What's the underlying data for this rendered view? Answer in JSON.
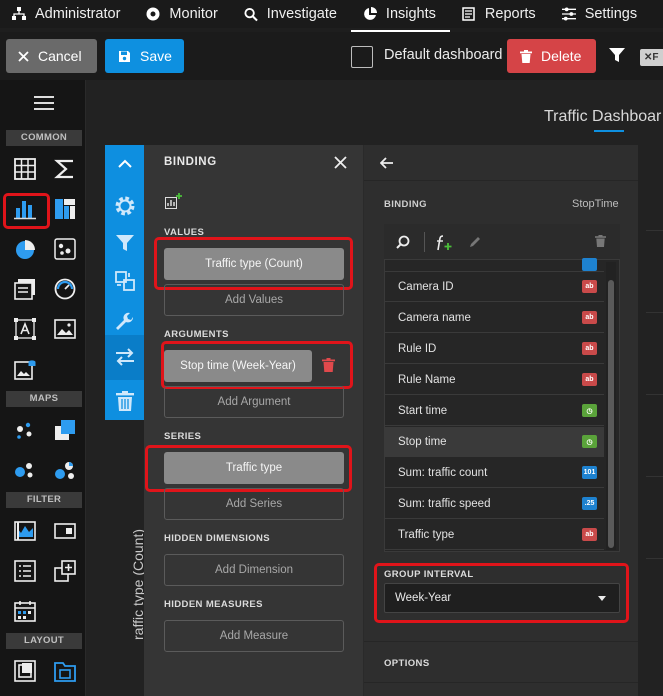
{
  "nav": {
    "items": [
      {
        "label": "Administrator",
        "icon": "org-chart-icon"
      },
      {
        "label": "Monitor",
        "icon": "camera-icon"
      },
      {
        "label": "Investigate",
        "icon": "search-icon"
      },
      {
        "label": "Insights",
        "icon": "pie-chart-icon",
        "active": true
      },
      {
        "label": "Reports",
        "icon": "report-icon"
      },
      {
        "label": "Settings",
        "icon": "sliders-icon"
      }
    ]
  },
  "toolbar": {
    "cancel_label": "Cancel",
    "save_label": "Save",
    "default_dashboard_label": "Default dashboard",
    "default_dashboard_checked": false,
    "delete_label": "Delete",
    "filter_chip": "F"
  },
  "toolbox": {
    "sections": {
      "common": "COMMON",
      "maps": "MAPS",
      "filter": "FILTER",
      "layout": "LAYOUT"
    }
  },
  "canvas": {
    "title": "Traffic Dashboar",
    "axis_label": "raffic type (Count)"
  },
  "binding_panel": {
    "title": "BINDING",
    "values_label": "VALUES",
    "values_item": "Traffic type (Count)",
    "add_values": "Add Values",
    "arguments_label": "ARGUMENTS",
    "arguments_item": "Stop time (Week-Year)",
    "add_argument": "Add Argument",
    "series_label": "SERIES",
    "series_item": "Traffic type",
    "add_series": "Add Series",
    "hidden_dimensions_label": "HIDDEN DIMENSIONS",
    "add_dimension": "Add Dimension",
    "hidden_measures_label": "HIDDEN MEASURES",
    "add_measure": "Add Measure"
  },
  "field_panel": {
    "binding_label": "BINDING",
    "field_name": "StopTime",
    "fields": [
      {
        "label": "Camera ID",
        "type": "ab"
      },
      {
        "label": "Camera name",
        "type": "ab"
      },
      {
        "label": "Rule ID",
        "type": "ab"
      },
      {
        "label": "Rule Name",
        "type": "ab"
      },
      {
        "label": "Start time",
        "type": "time"
      },
      {
        "label": "Stop time",
        "type": "time",
        "selected": true
      },
      {
        "label": "Sum: traffic count",
        "type": "num",
        "badge": "101"
      },
      {
        "label": "Sum: traffic speed",
        "type": "num",
        "badge": ".25"
      },
      {
        "label": "Traffic type",
        "type": "ab"
      }
    ],
    "group_interval_label": "GROUP INTERVAL",
    "group_interval_value": "Week-Year",
    "options_label": "OPTIONS"
  },
  "colors": {
    "accent_blue": "#0e90e0",
    "delete_red": "#d54447",
    "highlight_red": "#e0141a",
    "badge_text": "#c94a4a",
    "badge_time": "#5aa33a",
    "badge_number": "#1e82d0"
  }
}
